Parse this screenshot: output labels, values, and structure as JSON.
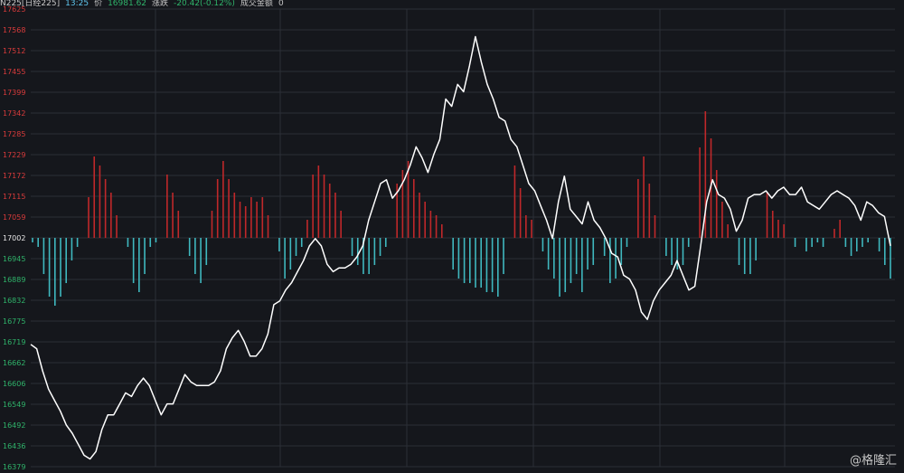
{
  "header": {
    "symbol": "N225[日经225]",
    "time": "13:25",
    "price_label": "价",
    "price": "16981.62",
    "change_label": "涨跌",
    "change": "-20.42(-0.12%)",
    "turnover_label": "成交金额",
    "turnover": "0"
  },
  "watermark": "@格隆汇",
  "colors": {
    "background": "#15171c",
    "grid": "#2b2f36",
    "up_bar": "#c0282a",
    "down_bar": "#3fb8bf",
    "price_line": "#ffffff",
    "axis_up_text": "#d93b3b",
    "axis_down_text": "#2fb36a",
    "baseline_text": "#e6e6e6"
  },
  "chart_data": {
    "type": "line",
    "baseline": 17002,
    "ylim": [
      16379,
      17625
    ],
    "y_ticks_up": [
      "17625",
      "17568",
      "17512",
      "17455",
      "17399",
      "17342",
      "17285",
      "17229",
      "17172",
      "17115",
      "17059"
    ],
    "y_tick_base": "17002",
    "y_ticks_down": [
      "16945",
      "16889",
      "16832",
      "16775",
      "16719",
      "16662",
      "16606",
      "16549",
      "16492",
      "16436",
      "16379"
    ],
    "price_series": [
      16712,
      16700,
      16640,
      16590,
      16560,
      16530,
      16492,
      16470,
      16440,
      16410,
      16400,
      16420,
      16480,
      16520,
      16520,
      16550,
      16580,
      16570,
      16600,
      16620,
      16600,
      16560,
      16520,
      16550,
      16550,
      16590,
      16630,
      16610,
      16600,
      16600,
      16600,
      16610,
      16640,
      16700,
      16730,
      16750,
      16720,
      16680,
      16680,
      16700,
      16740,
      16820,
      16830,
      16860,
      16880,
      16910,
      16940,
      16980,
      17000,
      16980,
      16930,
      16910,
      16920,
      16920,
      16930,
      16950,
      16980,
      17050,
      17100,
      17150,
      17160,
      17110,
      17130,
      17160,
      17200,
      17250,
      17220,
      17180,
      17230,
      17270,
      17380,
      17360,
      17420,
      17400,
      17470,
      17550,
      17480,
      17420,
      17380,
      17330,
      17320,
      17270,
      17250,
      17200,
      17150,
      17130,
      17090,
      17050,
      17000,
      17100,
      17170,
      17080,
      17060,
      17040,
      17100,
      17050,
      17030,
      17000,
      16960,
      16950,
      16900,
      16890,
      16860,
      16800,
      16780,
      16830,
      16860,
      16880,
      16900,
      16940,
      16900,
      16860,
      16870,
      16980,
      17100,
      17160,
      17120,
      17110,
      17080,
      17020,
      17050,
      17110,
      17120,
      17120,
      17130,
      17110,
      17130,
      17140,
      17120,
      17120,
      17140,
      17100,
      17090,
      17080,
      17100,
      17120,
      17130,
      17120,
      17110,
      17090,
      17050,
      17100,
      17090,
      17070,
      17060,
      16980
    ],
    "volume_bars": [
      -10,
      -20,
      -80,
      -130,
      -150,
      -130,
      -100,
      -50,
      -20,
      0,
      90,
      180,
      160,
      130,
      100,
      50,
      0,
      -20,
      -100,
      -120,
      -80,
      -20,
      -10,
      0,
      140,
      100,
      60,
      0,
      -40,
      -80,
      -100,
      -60,
      60,
      130,
      170,
      130,
      100,
      80,
      70,
      90,
      80,
      90,
      50,
      0,
      -30,
      -90,
      -70,
      -40,
      -20,
      40,
      140,
      160,
      140,
      120,
      100,
      60,
      0,
      -40,
      -60,
      -80,
      -80,
      -60,
      -40,
      -20,
      0,
      120,
      150,
      170,
      130,
      100,
      80,
      60,
      50,
      30,
      0,
      -70,
      -90,
      -100,
      -100,
      -110,
      -110,
      -120,
      -120,
      -130,
      -80,
      0,
      160,
      110,
      50,
      40,
      0,
      -30,
      -70,
      -90,
      -130,
      -120,
      -100,
      -80,
      -120,
      -70,
      -60,
      0,
      -40,
      -100,
      -90,
      -60,
      -20,
      0,
      130,
      180,
      120,
      50,
      0,
      -40,
      -60,
      -70,
      -60,
      -20,
      0,
      200,
      280,
      220,
      150,
      80,
      30,
      0,
      -60,
      -80,
      -80,
      -50,
      0,
      100,
      60,
      40,
      30,
      0,
      -20,
      0,
      -30,
      -20,
      -10,
      -20,
      0,
      20,
      40,
      -20,
      -40,
      -30,
      -20,
      -10,
      0,
      -30,
      -60,
      -90
    ]
  }
}
